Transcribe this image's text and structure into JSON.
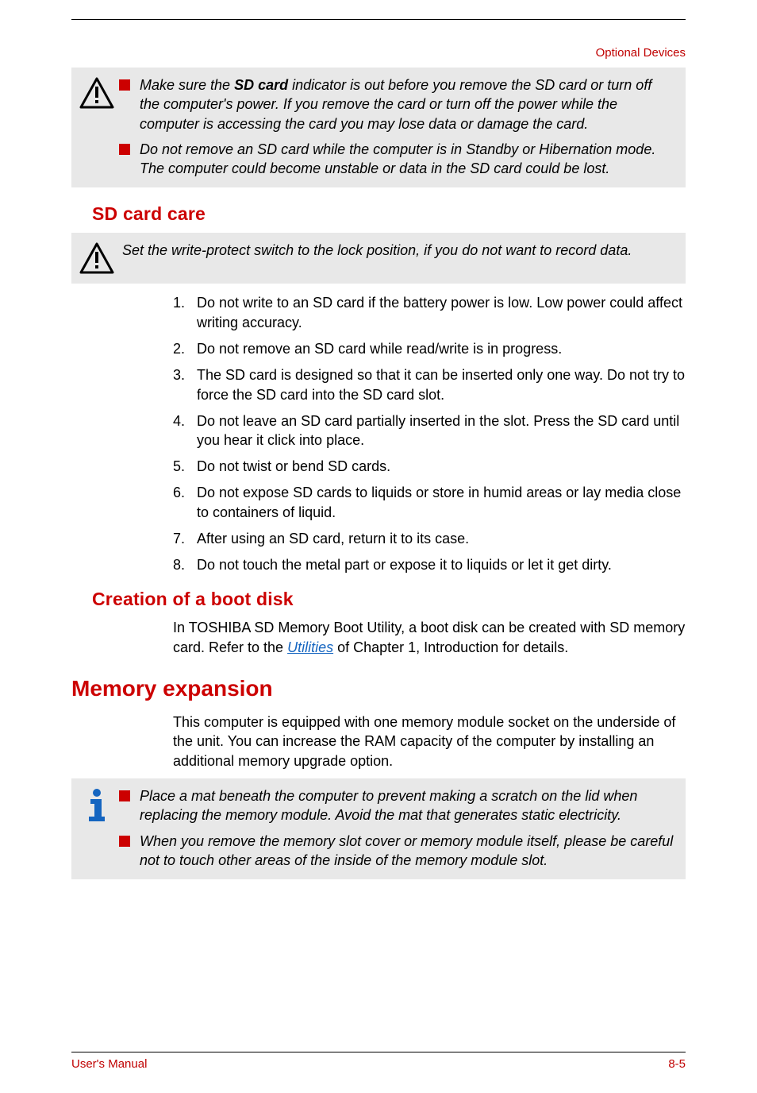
{
  "header": {
    "section": "Optional Devices"
  },
  "warnBox1": {
    "items": [
      {
        "pre": "Make sure the ",
        "bold": "SD card",
        "post": " indicator is out before you remove the SD card or turn off the computer's power. If you remove the card or turn off the power while the computer is accessing the card you may lose data or damage the card."
      },
      {
        "text": "Do not remove an SD card while the computer is in Standby or Hibernation mode. The computer could become unstable or data in the SD card could be lost."
      }
    ]
  },
  "sdCare": {
    "title": "SD card care",
    "note": "Set the write-protect switch to the lock position, if you do not want to record data.",
    "items": [
      "Do not write to an SD card if the battery power is low. Low power could affect writing accuracy.",
      "Do not remove an SD card while read/write is in progress.",
      "The SD card is designed so that it can be inserted only one way. Do not try to force the SD card into the SD card slot.",
      "Do not leave an SD card partially inserted in the slot. Press the SD card until you hear it click into place.",
      "Do not twist or bend SD cards.",
      "Do not expose SD cards to liquids or store in humid areas or lay media close to containers of liquid.",
      "After using an SD card, return it to its case.",
      "Do not touch the metal part or expose it to liquids or let it get dirty."
    ]
  },
  "bootDisk": {
    "title": "Creation of a boot disk",
    "pre": "In TOSHIBA SD Memory Boot Utility, a boot disk can be created with SD memory card. Refer to the ",
    "link": "Utilities",
    "post": " of Chapter 1, Introduction for details."
  },
  "memExp": {
    "title": "Memory expansion",
    "para": "This computer is equipped with one memory module socket on the underside of the unit. You can increase the RAM capacity of the computer by installing an additional memory upgrade option.",
    "notes": [
      "Place a mat beneath the computer to prevent making a scratch on the lid when replacing the memory module. Avoid the mat that generates static electricity.",
      "When you remove the memory slot cover or memory module itself, please be careful not to touch other areas of the inside of the memory module slot."
    ]
  },
  "footer": {
    "left": "User's Manual",
    "right": "8-5"
  }
}
